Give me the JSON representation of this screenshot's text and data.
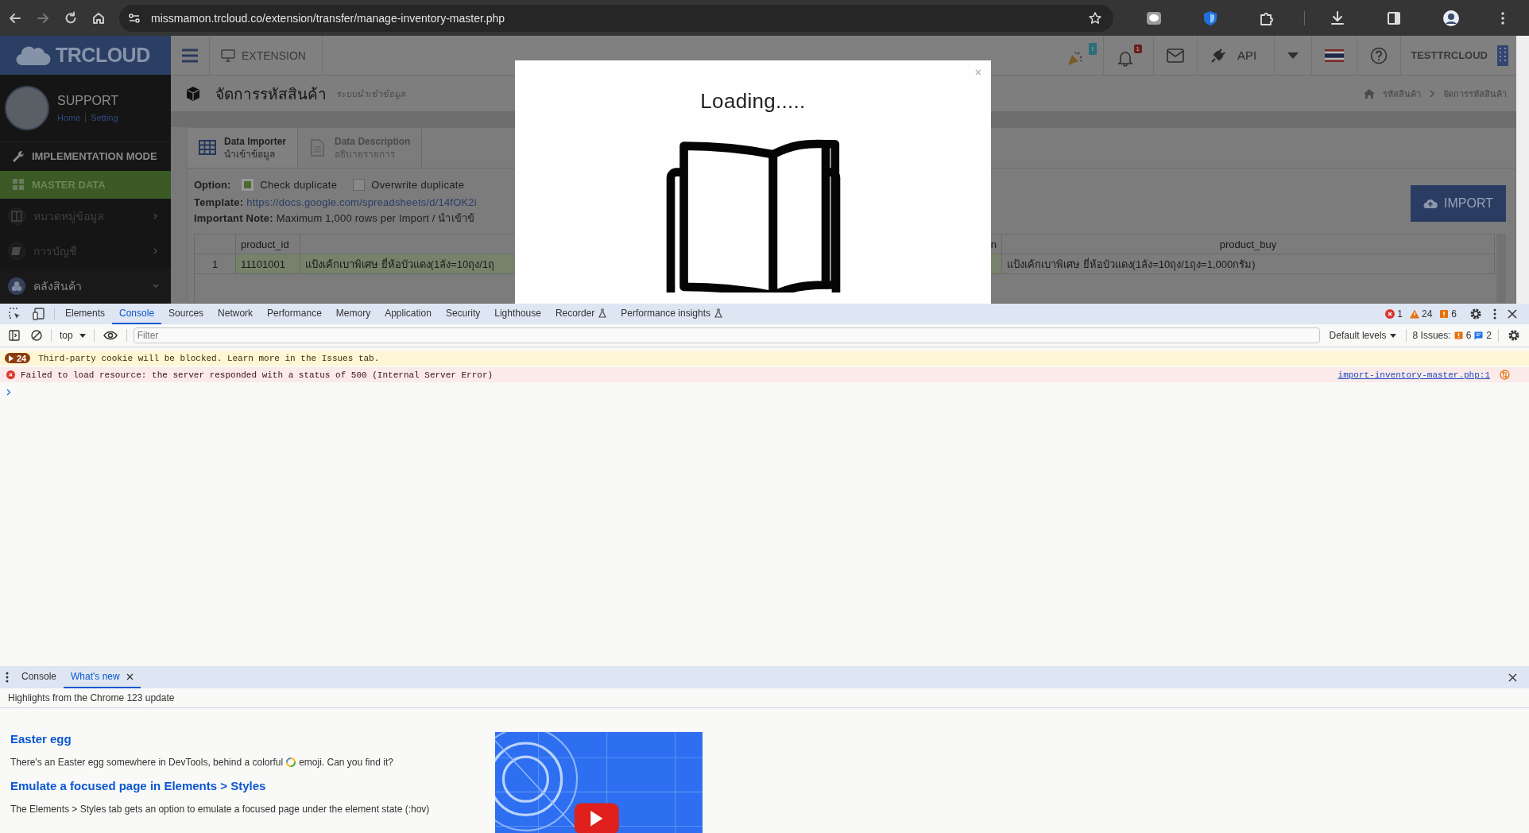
{
  "browser": {
    "url": "missmamon.trcloud.co/extension/transfer/manage-inventory-master.php"
  },
  "app": {
    "brand": "TRCLOUD",
    "top_nav": {
      "module": "EXTENSION",
      "celebration_badge": "!",
      "notification_badge": "1",
      "api": "API",
      "user": "TESTTRCLOUD"
    },
    "profile": {
      "name": "SUPPORT",
      "links": [
        "Home",
        "Setting"
      ]
    },
    "sidebar": {
      "sections": [
        {
          "label": "IMPLEMENTATION MODE",
          "kind": "wrench",
          "selected": false
        },
        {
          "label": "MASTER DATA",
          "kind": "grid",
          "selected": true
        }
      ],
      "groups": [
        {
          "label": "หมวดหมู่ข้อมูล",
          "kind": "columns",
          "expanded": false
        },
        {
          "label": "การบัญชี",
          "kind": "book",
          "expanded": false
        },
        {
          "label": "คลังสินค้า",
          "kind": "boxes",
          "expanded": true
        }
      ]
    },
    "page": {
      "title": "จัดการรหัสสินค้า",
      "subtitle": "ระบบนำเข้าข้อมูล",
      "breadcrumb": [
        "รหัสสินค้า",
        "จัดการรหัสสินค้า"
      ]
    },
    "tabs": [
      {
        "title": "Data Importer",
        "subtitle": "นำเข้าข้อมูล",
        "kind": "table",
        "selected": true
      },
      {
        "title": "Data Description",
        "subtitle": "อธิบายรายการ",
        "kind": "document",
        "selected": false
      }
    ],
    "options": {
      "label": "Option:",
      "items": [
        {
          "label": "Check duplicate",
          "checked": true
        },
        {
          "label": "Overwrite duplicate",
          "checked": false
        }
      ]
    },
    "template": {
      "label": "Template:",
      "link": "https://docs.google.com/spreadsheets/d/14fOK2i"
    },
    "note": {
      "label": "Important Note:",
      "text": "Maximum 1,000 rows per Import / นำเข้าข้"
    },
    "import_button": "IMPORT",
    "table": {
      "columns": [
        "product_id",
        "n",
        "product_buy"
      ],
      "rows": [
        {
          "number": "1",
          "cells": [
            "11101001",
            "แป้งเค้กเบาพิเศษ ยี่ห้อบัวแดง(1ลัง=10ถุง/1ถุ",
            "แป้งเค้กเบาพิเศษ ยี่ห้อบัวแดง(1ลัง=10ถุง/1ถุง=1,000กรัม)"
          ]
        }
      ]
    }
  },
  "modal": {
    "title": "Loading.....",
    "close": "×"
  },
  "devtools": {
    "tabs": [
      {
        "label": "Elements",
        "kind": "plain",
        "selected": false
      },
      {
        "label": "Console",
        "kind": "plain",
        "selected": true
      },
      {
        "label": "Sources",
        "kind": "plain",
        "selected": false
      },
      {
        "label": "Network",
        "kind": "plain",
        "selected": false
      },
      {
        "label": "Performance",
        "kind": "plain",
        "selected": false
      },
      {
        "label": "Memory",
        "kind": "plain",
        "selected": false
      },
      {
        "label": "Application",
        "kind": "plain",
        "selected": false
      },
      {
        "label": "Security",
        "kind": "plain",
        "selected": false
      },
      {
        "label": "Lighthouse",
        "kind": "plain",
        "selected": false
      },
      {
        "label": "Recorder",
        "kind": "experimental",
        "selected": false
      },
      {
        "label": "Performance insights",
        "kind": "experimental",
        "selected": false
      }
    ],
    "counts": {
      "errors": "1",
      "warnings": "24",
      "issues": "6"
    },
    "toolbar": {
      "context": "top",
      "filter_placeholder": "Filter",
      "levels": "Default levels",
      "issues_label": "8 Issues:",
      "issue_count": "6",
      "message_count": "2"
    },
    "messages": [
      {
        "kind": "warning",
        "count": "24",
        "text": "Third-party cookie will be blocked. Learn more in the Issues tab."
      },
      {
        "kind": "error",
        "text": "Failed to load resource: the server responded with a status of 500 (Internal Server Error)",
        "source": "import-inventory-master.php:1"
      }
    ],
    "drawer": {
      "tabs": [
        {
          "label": "Console",
          "selected": false,
          "closable": false
        },
        {
          "label": "What's new",
          "selected": true,
          "closable": true
        }
      ],
      "subtitle": "Highlights from the Chrome 123 update",
      "features": [
        {
          "title": "Easter egg",
          "text": "There's an Easter egg somewhere in DevTools, behind a colorful",
          "text_after": "emoji. Can you find it?"
        },
        {
          "title": "Emulate a focused page in Elements > Styles",
          "text": "The Elements > Styles tab gets an option to emulate a focused page under the element state (:hov)"
        }
      ]
    }
  }
}
